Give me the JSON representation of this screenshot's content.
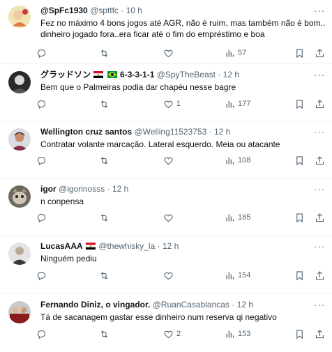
{
  "tweets": [
    {
      "name": "@SpFc1930",
      "handle": "@spttfc",
      "time": "10 h",
      "text_lines": [
        "Fez no máximo 4 bons jogos até AGR, não é ruim, mas também não é bom..",
        "dinheiro jogado fora..era ficar até o fim do empréstimo e boa"
      ],
      "replies": "",
      "retweets": "",
      "likes": "",
      "views": "57"
    },
    {
      "name": "グラッドソン",
      "name_suffix": "6-3-3-1-1",
      "handle": "@SpyTheBeast",
      "time": "12 h",
      "text_lines": [
        "Bem que o Palmeiras podia dar chapéu nesse bagre"
      ],
      "replies": "",
      "retweets": "",
      "likes": "1",
      "views": "177"
    },
    {
      "name": "Wellington cruz santos",
      "handle": "@Welling11523753",
      "time": "12 h",
      "text_lines": [
        "Contratar volante marcação. Lateral esquerdo. Meia ou atacante"
      ],
      "replies": "",
      "retweets": "",
      "likes": "",
      "views": "108"
    },
    {
      "name": "igor",
      "handle": "@igorinosss",
      "time": "12 h",
      "text_lines": [
        "n conpensa"
      ],
      "replies": "",
      "retweets": "",
      "likes": "",
      "views": "185"
    },
    {
      "name": "LucasAAA",
      "handle": "@thewhisky_la",
      "time": "12 h",
      "text_lines": [
        "Ninguém pediu"
      ],
      "replies": "",
      "retweets": "",
      "likes": "",
      "views": "154"
    },
    {
      "name": "Fernando Diniz, o vingador.",
      "handle": "@RuanCasablancas",
      "time": "12 h",
      "text_lines": [
        "Tá de sacanagem gastar esse dinheiro num reserva qi negativo"
      ],
      "replies": "",
      "retweets": "",
      "likes": "2",
      "views": "153"
    }
  ],
  "ui": {
    "dot": "·",
    "more": "···"
  },
  "colors": {
    "text": "#0f1419",
    "secondary": "#536471",
    "border": "#eff3f4"
  },
  "icons": [
    "reply-icon",
    "retweet-icon",
    "like-icon",
    "views-icon",
    "bookmark-icon",
    "share-icon",
    "more-icon"
  ]
}
